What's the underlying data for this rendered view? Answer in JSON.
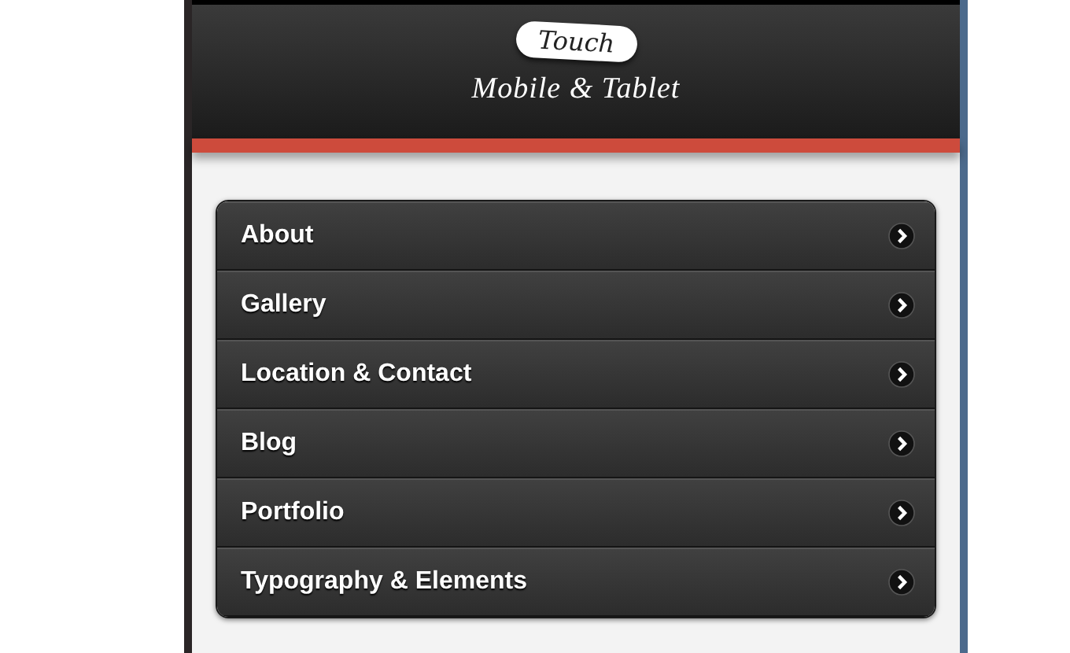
{
  "header": {
    "logo": "Touch",
    "tagline": "Mobile & Tablet"
  },
  "menu": [
    {
      "label": "About"
    },
    {
      "label": "Gallery"
    },
    {
      "label": "Location & Contact"
    },
    {
      "label": "Blog"
    },
    {
      "label": "Portfolio"
    },
    {
      "label": "Typography & Elements"
    }
  ]
}
